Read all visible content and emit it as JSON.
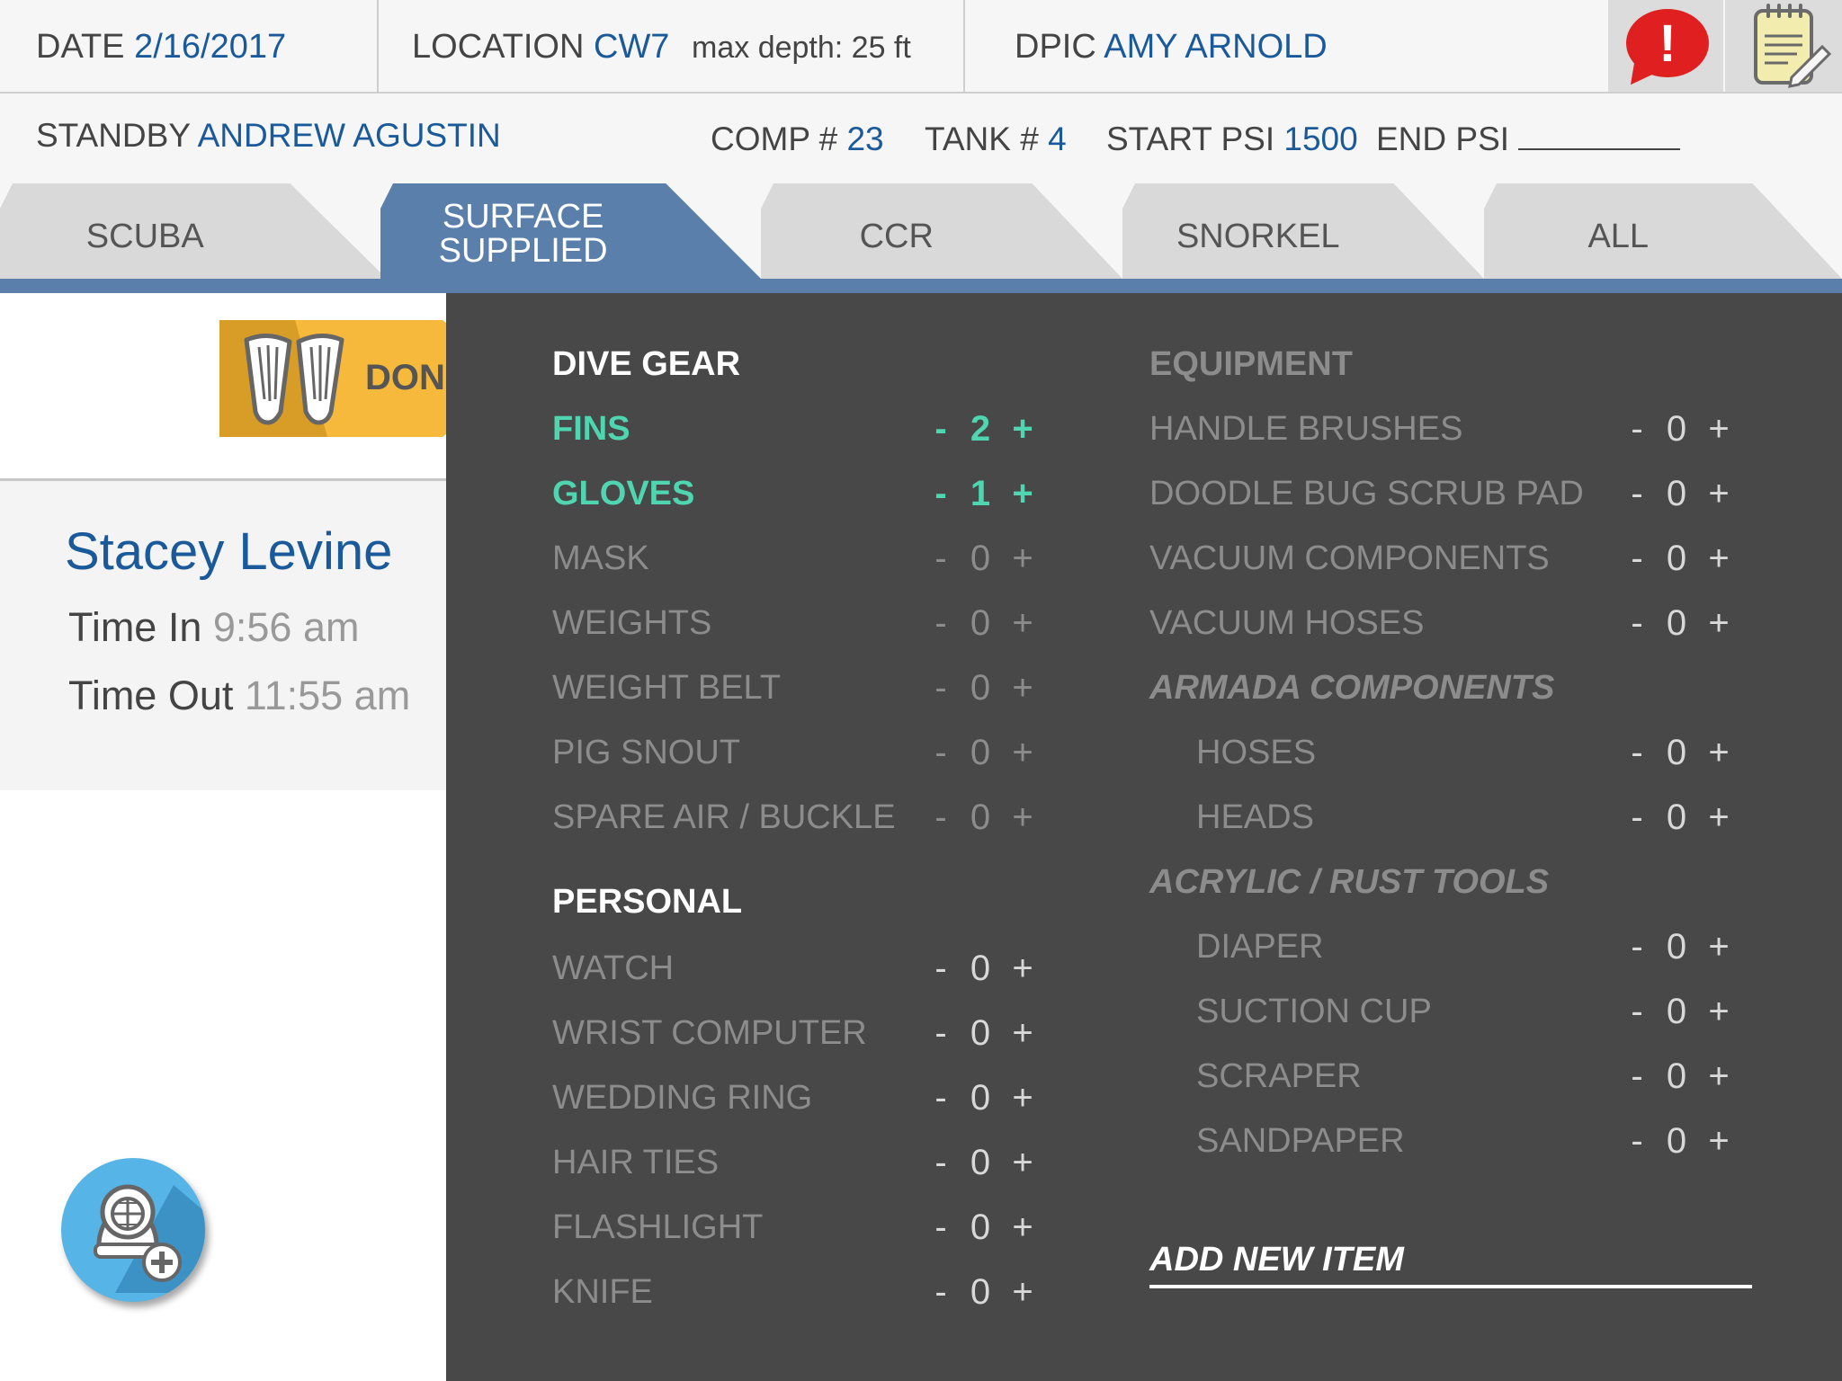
{
  "header": {
    "date_label": "DATE",
    "date_value": "2/16/2017",
    "location_label": "LOCATION",
    "location_value": "CW7",
    "max_depth": "max depth: 25 ft",
    "dpic_label": "DPIC",
    "dpic_value": "AMY ARNOLD",
    "alert_icon": "!",
    "standby_label": "STANDBY",
    "standby_value": "ANDREW AGUSTIN",
    "comp_label": "COMP #",
    "comp_value": "23",
    "tank_label": "TANK #",
    "tank_value": "4",
    "start_psi_label": "START PSI",
    "start_psi_value": "1500",
    "end_psi_label": "END PSI",
    "end_psi_value": ""
  },
  "tabs": [
    {
      "label": "SCUBA",
      "active": false
    },
    {
      "label": "SURFACE SUPPLIED",
      "active": true
    },
    {
      "label": "CCR",
      "active": false
    },
    {
      "label": "SNORKEL",
      "active": false
    },
    {
      "label": "ALL",
      "active": false
    }
  ],
  "done_label": "DONE",
  "diver": {
    "name": "Stacey Levine",
    "time_in_label": "Time In",
    "time_in": "9:56 am",
    "time_out_label": "Time Out",
    "time_out": "11:55 am"
  },
  "dive_gear": {
    "title": "DIVE GEAR",
    "items": [
      {
        "name": "FINS",
        "count": "2",
        "minus": "-",
        "plus": "+"
      },
      {
        "name": "GLOVES",
        "count": "1",
        "minus": "-",
        "plus": "+"
      },
      {
        "name": "MASK",
        "count": "0",
        "minus": "-",
        "plus": "+"
      },
      {
        "name": "WEIGHTS",
        "count": "0",
        "minus": "-",
        "plus": "+"
      },
      {
        "name": "WEIGHT BELT",
        "count": "0",
        "minus": "-",
        "plus": "+"
      },
      {
        "name": "PIG SNOUT",
        "count": "0",
        "minus": "-",
        "plus": "+"
      },
      {
        "name": "SPARE AIR / BUCKLE",
        "count": "0",
        "minus": "-",
        "plus": "+"
      }
    ]
  },
  "personal": {
    "title": "PERSONAL",
    "items": [
      {
        "name": "WATCH",
        "count": "0",
        "minus": "-",
        "plus": "+"
      },
      {
        "name": "WRIST COMPUTER",
        "count": "0",
        "minus": "-",
        "plus": "+"
      },
      {
        "name": "WEDDING RING",
        "count": "0",
        "minus": "-",
        "plus": "+"
      },
      {
        "name": "HAIR TIES",
        "count": "0",
        "minus": "-",
        "plus": "+"
      },
      {
        "name": "FLASHLIGHT",
        "count": "0",
        "minus": "-",
        "plus": "+"
      },
      {
        "name": "KNIFE",
        "count": "0",
        "minus": "-",
        "plus": "+"
      }
    ]
  },
  "equipment": {
    "title": "EQUIPMENT",
    "items": [
      {
        "name": "HANDLE BRUSHES",
        "count": "0",
        "minus": "-",
        "plus": "+"
      },
      {
        "name": "DOODLE BUG SCRUB PAD",
        "count": "0",
        "minus": "-",
        "plus": "+"
      },
      {
        "name": "VACUUM COMPONENTS",
        "count": "0",
        "minus": "-",
        "plus": "+"
      },
      {
        "name": "VACUUM HOSES",
        "count": "0",
        "minus": "-",
        "plus": "+"
      }
    ],
    "armada": {
      "title": "ARMADA COMPONENTS",
      "items": [
        {
          "name": "HOSES",
          "count": "0",
          "minus": "-",
          "plus": "+"
        },
        {
          "name": "HEADS",
          "count": "0",
          "minus": "-",
          "plus": "+"
        }
      ]
    },
    "acrylic": {
      "title": "ACRYLIC / RUST TOOLS",
      "items": [
        {
          "name": "DIAPER",
          "count": "0",
          "minus": "-",
          "plus": "+"
        },
        {
          "name": "SUCTION CUP",
          "count": "0",
          "minus": "-",
          "plus": "+"
        },
        {
          "name": "SCRAPER",
          "count": "0",
          "minus": "-",
          "plus": "+"
        },
        {
          "name": "SANDPAPER",
          "count": "0",
          "minus": "-",
          "plus": "+"
        }
      ]
    }
  },
  "add_new_item": "ADD NEW ITEM",
  "icons": [
    "alert-icon",
    "notepad-icon",
    "fins-icon",
    "diver-helmet-add-icon"
  ],
  "colors": {
    "accent_blue": "#1a5a9a",
    "tab_active": "#5a7fab",
    "panel_bg": "#484848",
    "active_item": "#4fd6b0",
    "done_badge": "#f6b93b",
    "alert_red": "#e02020",
    "fab_blue": "#56b4e6"
  }
}
